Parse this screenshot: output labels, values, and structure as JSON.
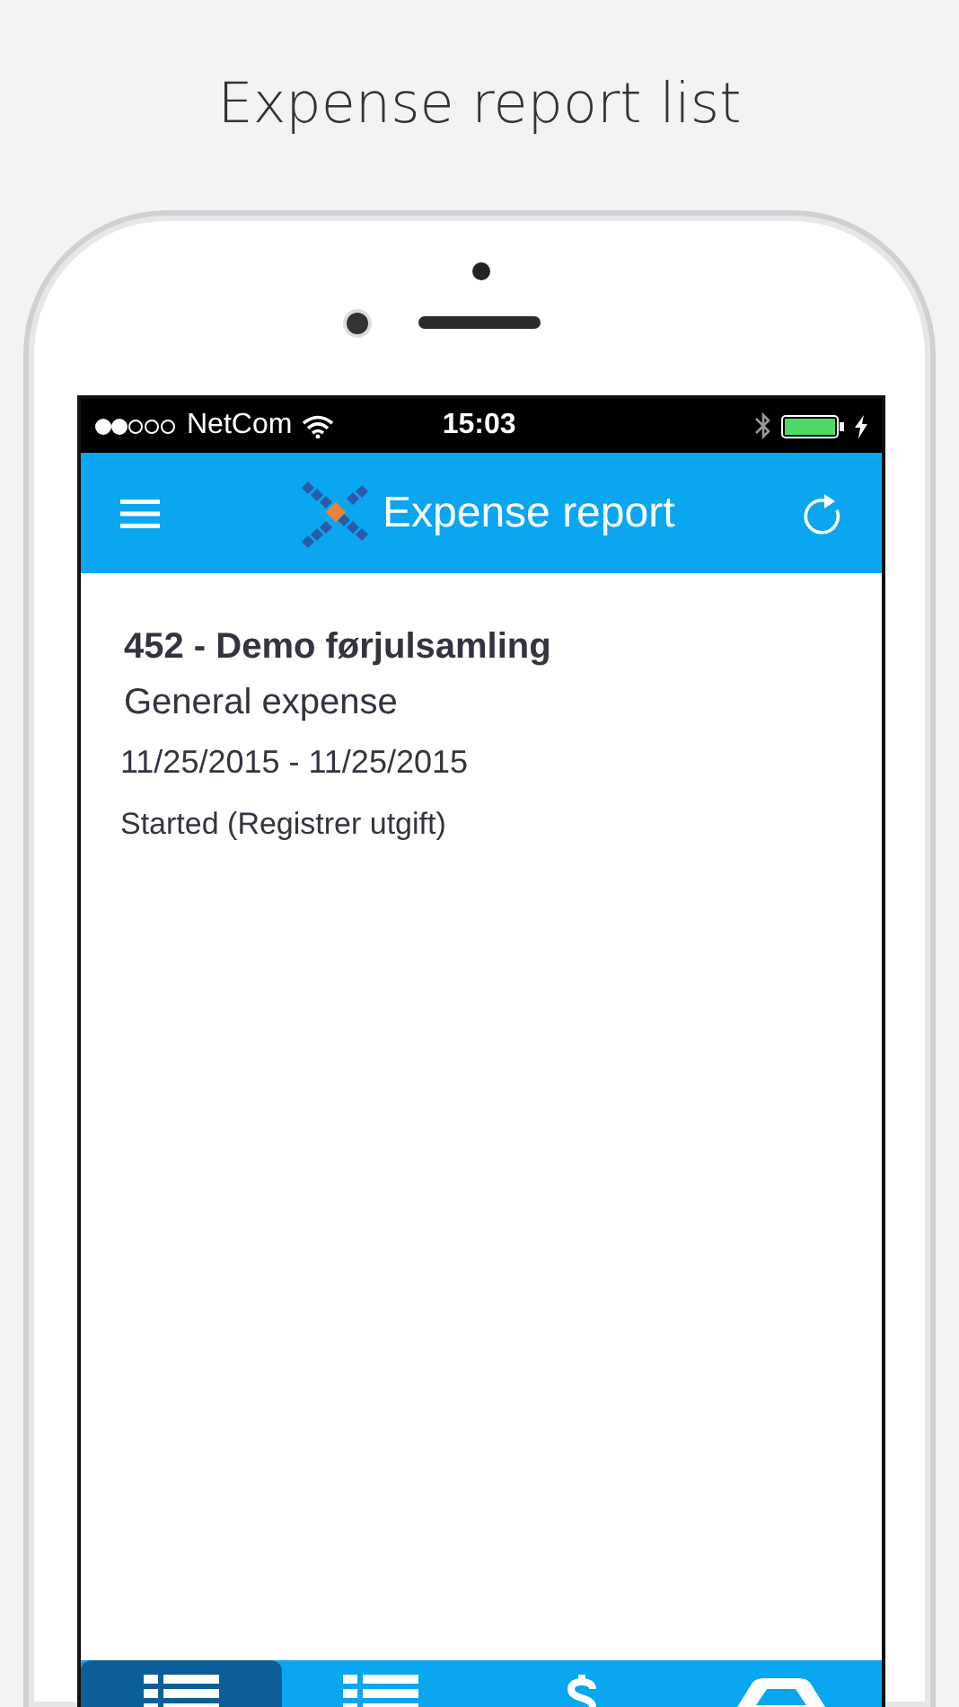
{
  "caption": "Expense report list",
  "status_bar": {
    "carrier": "NetCom",
    "time": "15:03"
  },
  "header": {
    "title": "Expense report"
  },
  "report": {
    "title": "452 - Demo førjulsamling",
    "type": "General expense",
    "dates": "11/25/2015 - 11/25/2015",
    "status": "Started (Registrer utgift)"
  },
  "tabs": [
    {
      "kind": "list",
      "selected": true
    },
    {
      "kind": "list",
      "selected": false
    },
    {
      "kind": "money",
      "selected": false
    },
    {
      "kind": "car",
      "selected": false
    }
  ]
}
